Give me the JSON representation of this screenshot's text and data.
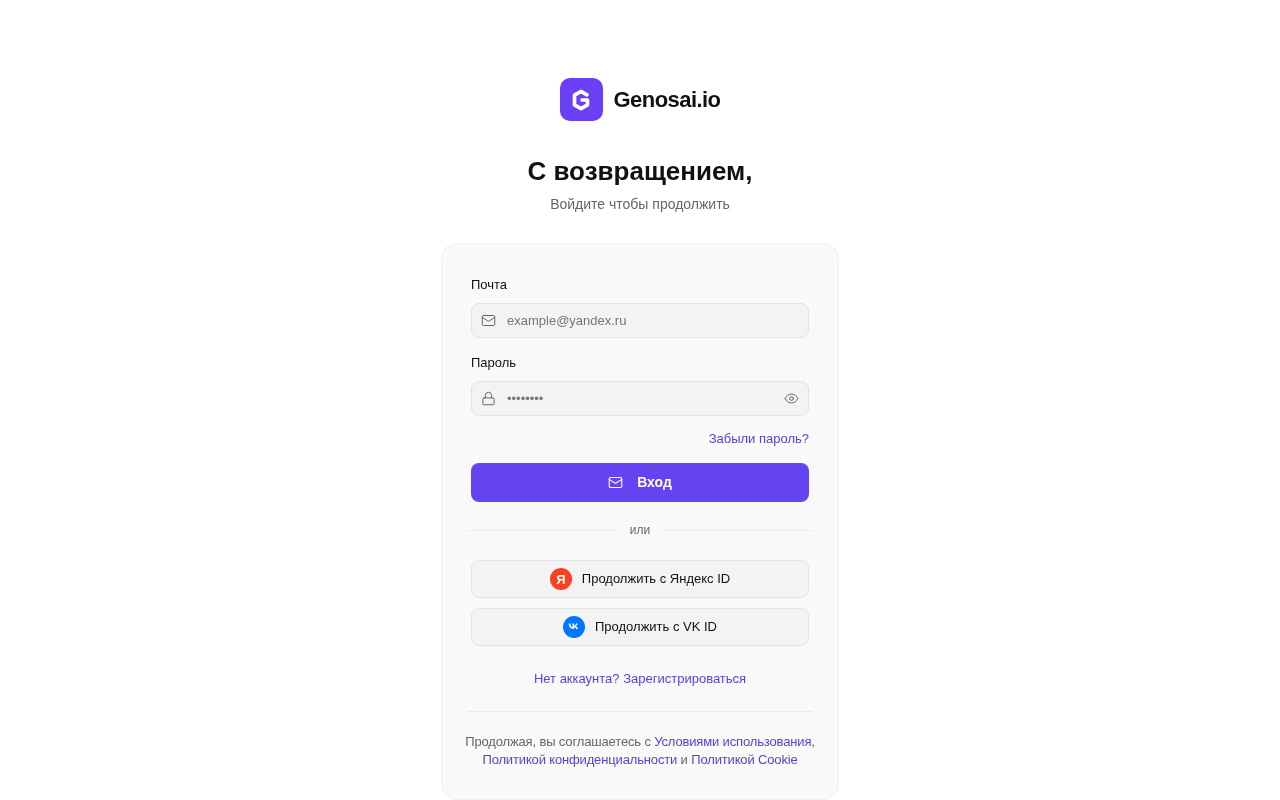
{
  "brand": {
    "name": "Genosai.io"
  },
  "heading": "С возвращением,",
  "subheading": "Войдите чтобы продолжить",
  "form": {
    "fields": [
      {
        "kind": "email",
        "label": "Почта",
        "placeholder": "example@yandex.ru"
      },
      {
        "kind": "password",
        "label": "Пароль",
        "placeholder": "••••••••"
      }
    ],
    "forgot_password_link": "Забыли пароль?",
    "submit_button": "Вход",
    "divider": "или",
    "social_buttons": [
      {
        "kind": "yandex",
        "label": "Продолжить с Яндекс ID",
        "icon_letter": "Я"
      },
      {
        "kind": "vk",
        "label": "Продолжить с VK ID"
      }
    ],
    "signup_link": "Нет аккаунта? Зарегистрироваться",
    "terms": [
      {
        "kind": "text",
        "text": "Продолжая, вы соглашаетесь с "
      },
      {
        "kind": "link",
        "text": "Условиями использования"
      },
      {
        "kind": "text",
        "text": ", "
      },
      {
        "kind": "link",
        "text": "Политикой конфиденциальности"
      },
      {
        "kind": "text",
        "text": " и "
      },
      {
        "kind": "link",
        "text": "Политикой Cookie"
      }
    ]
  }
}
